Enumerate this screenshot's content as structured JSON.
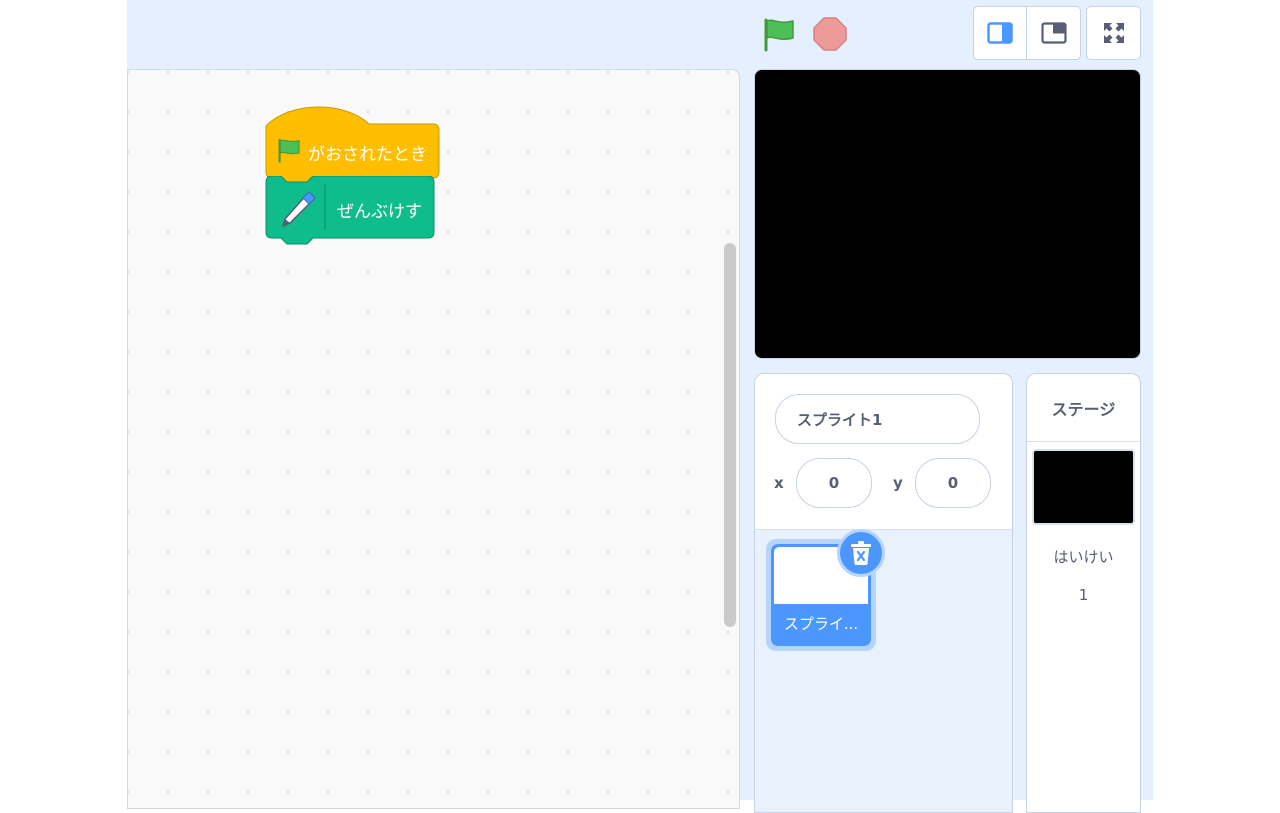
{
  "blocks": {
    "hat_label": "がおされたとき",
    "pen_label": "ぜんぶけす"
  },
  "sprite": {
    "name": "スプライト1",
    "x_label": "x",
    "x_value": "0",
    "y_label": "y",
    "y_value": "0",
    "tile_label": "スプライ..."
  },
  "stage": {
    "header": "ステージ",
    "backdrop_label": "はいけい",
    "backdrop_count": "1"
  },
  "colors": {
    "events": "#ffbf00",
    "pen": "#0fbd8c",
    "selected": "#4c97ff",
    "flag": "#4cbf56",
    "stop": "#ec5959"
  },
  "icons": {
    "flag": "green-flag-icon",
    "stop": "stop-icon",
    "pen": "pen-icon",
    "small_stage": "small-stage-icon",
    "large_stage": "large-stage-icon",
    "fullscreen": "fullscreen-icon",
    "delete": "trash-icon"
  }
}
